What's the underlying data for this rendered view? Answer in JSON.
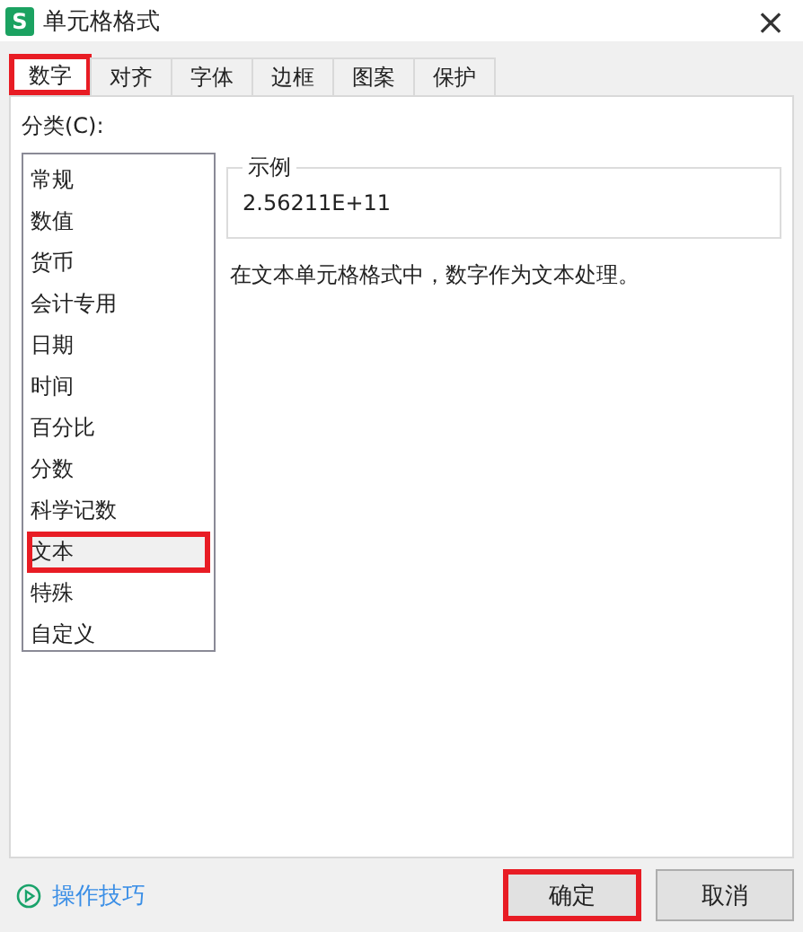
{
  "window": {
    "logo": "S",
    "title": "单元格格式",
    "close": "×"
  },
  "tabs": [
    {
      "label": "数字",
      "selected": true,
      "highlighted": true
    },
    {
      "label": "对齐",
      "selected": false,
      "highlighted": false
    },
    {
      "label": "字体",
      "selected": false,
      "highlighted": false
    },
    {
      "label": "边框",
      "selected": false,
      "highlighted": false
    },
    {
      "label": "图案",
      "selected": false,
      "highlighted": false
    },
    {
      "label": "保护",
      "selected": false,
      "highlighted": false
    }
  ],
  "category": {
    "label": "分类(C):",
    "items": [
      {
        "label": "常规",
        "selected": false,
        "highlighted": false
      },
      {
        "label": "数值",
        "selected": false,
        "highlighted": false
      },
      {
        "label": "货币",
        "selected": false,
        "highlighted": false
      },
      {
        "label": "会计专用",
        "selected": false,
        "highlighted": false
      },
      {
        "label": "日期",
        "selected": false,
        "highlighted": false
      },
      {
        "label": "时间",
        "selected": false,
        "highlighted": false
      },
      {
        "label": "百分比",
        "selected": false,
        "highlighted": false
      },
      {
        "label": "分数",
        "selected": false,
        "highlighted": false
      },
      {
        "label": "科学记数",
        "selected": false,
        "highlighted": false
      },
      {
        "label": "文本",
        "selected": true,
        "highlighted": true
      },
      {
        "label": "特殊",
        "selected": false,
        "highlighted": false
      },
      {
        "label": "自定义",
        "selected": false,
        "highlighted": false
      }
    ]
  },
  "sample": {
    "legend": "示例",
    "value": "2.56211E+11"
  },
  "description": "在文本单元格格式中，数字作为文本处理。",
  "help_link": "操作技巧",
  "buttons": [
    {
      "label": "确定",
      "highlighted": true
    },
    {
      "label": "取消",
      "highlighted": false
    }
  ]
}
